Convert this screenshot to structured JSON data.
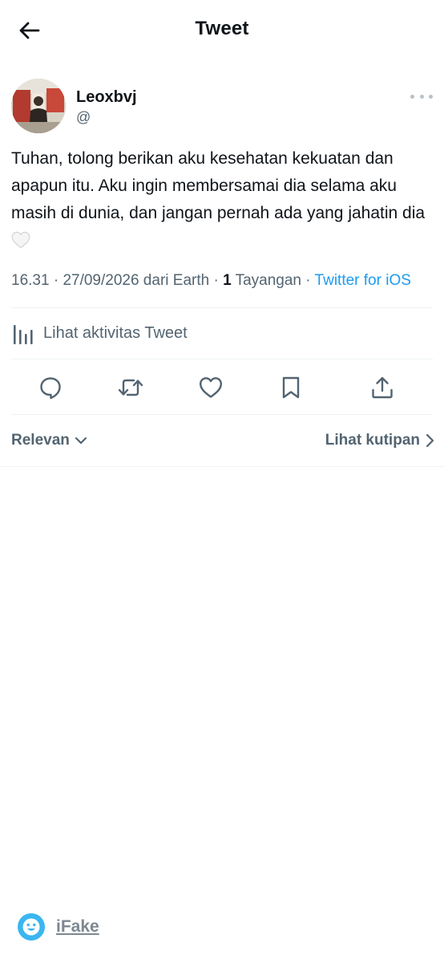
{
  "header": {
    "title": "Tweet",
    "back_icon": "arrow-left-icon"
  },
  "author": {
    "display_name": "Leoxbvj",
    "handle": "@",
    "more_icon": "more-horizontal-icon"
  },
  "tweet": {
    "text": "Tuhan, tolong berikan aku kesehatan kekuatan dan apapun itu. Aku ingin membersamai dia selama aku masih di dunia, dan jangan pernah ada yang jahatin dia",
    "emoji": "white-heart-emoji"
  },
  "meta": {
    "time": "16.31",
    "separator1": " · ",
    "date_location": "27/09/2026 dari Earth",
    "separator2": " · ",
    "views_count": "1",
    "views_label": " Tayangan",
    "separator3": " · ",
    "source": "Twitter for iOS"
  },
  "activity": {
    "label": "Lihat aktivitas Tweet",
    "icon": "analytics-bars-icon"
  },
  "actions": {
    "reply_icon": "reply-icon",
    "retweet_icon": "retweet-icon",
    "like_icon": "like-icon",
    "bookmark_icon": "bookmark-icon",
    "share_icon": "share-icon"
  },
  "replies_bar": {
    "sort_label": "Relevan",
    "quotes_label": "Lihat kutipan"
  },
  "watermark": {
    "label": "iFake",
    "icon": "smiley-icon"
  },
  "colors": {
    "text_primary": "#0f1419",
    "text_secondary": "#536471",
    "accent": "#1d9bf0",
    "divider": "#eff3f4",
    "watermark_icon": "#3ab6f0"
  }
}
